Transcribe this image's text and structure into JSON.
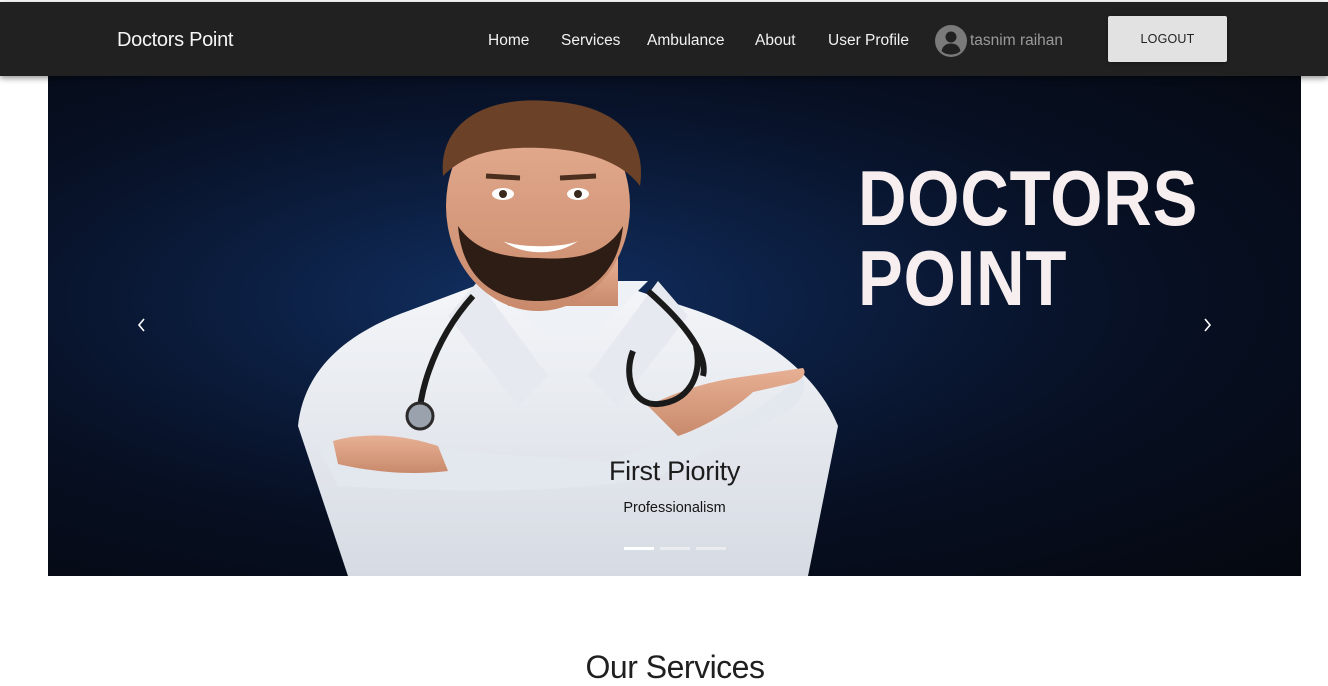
{
  "navbar": {
    "brand": "Doctors Point",
    "links": [
      "Home",
      "Services",
      "Ambulance",
      "About",
      "User Profile"
    ],
    "user_name": "tasnim raihan",
    "logout_label": "LOGOUT",
    "background": "#212121"
  },
  "carousel": {
    "logo_lines": [
      "DOCTORS",
      "POINT"
    ],
    "caption_title": "First Piority",
    "caption_subtitle": "Professionalism",
    "slide_count": 3,
    "active_slide": 1,
    "prev_icon": "chevron-left-icon",
    "next_icon": "chevron-right-icon"
  },
  "services": {
    "title": "Our Services"
  }
}
